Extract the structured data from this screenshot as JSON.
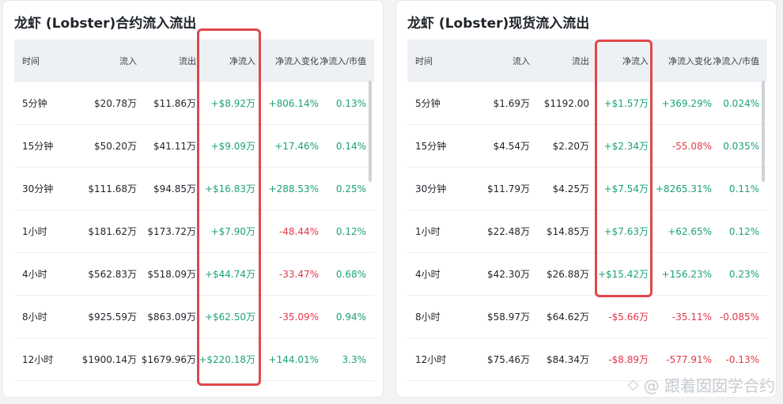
{
  "left_panel": {
    "title": "龙虾 (Lobster)合约流入流出",
    "headers": [
      "时间",
      "流入",
      "流出",
      "净流入",
      "净流入变化",
      "净流入/市值"
    ],
    "rows": [
      [
        "5分钟",
        "$20.78万",
        "$11.86万",
        "+$8.92万",
        "+806.14%",
        "0.13%"
      ],
      [
        "15分钟",
        "$50.20万",
        "$41.11万",
        "+$9.09万",
        "+17.46%",
        "0.14%"
      ],
      [
        "30分钟",
        "$111.68万",
        "$94.85万",
        "+$16.83万",
        "+288.53%",
        "0.25%"
      ],
      [
        "1小时",
        "$181.62万",
        "$173.72万",
        "+$7.90万",
        "-48.44%",
        "0.12%"
      ],
      [
        "4小时",
        "$562.83万",
        "$518.09万",
        "+$44.74万",
        "-33.47%",
        "0.68%"
      ],
      [
        "8小时",
        "$925.59万",
        "$863.09万",
        "+$62.50万",
        "-35.09%",
        "0.94%"
      ],
      [
        "12小时",
        "$1900.14万",
        "$1679.96万",
        "+$220.18万",
        "+144.01%",
        "3.3%"
      ]
    ]
  },
  "right_panel": {
    "title": "龙虾 (Lobster)现货流入流出",
    "headers": [
      "时间",
      "流入",
      "流出",
      "净流入",
      "净流入变化",
      "净流入/市值"
    ],
    "rows": [
      [
        "5分钟",
        "$1.69万",
        "$1192.00",
        "+$1.57万",
        "+369.29%",
        "0.024%"
      ],
      [
        "15分钟",
        "$4.54万",
        "$2.20万",
        "+$2.34万",
        "-55.08%",
        "0.035%"
      ],
      [
        "30分钟",
        "$11.79万",
        "$4.25万",
        "+$7.54万",
        "+8265.31%",
        "0.11%"
      ],
      [
        "1小时",
        "$22.48万",
        "$14.85万",
        "+$7.63万",
        "+62.65%",
        "0.12%"
      ],
      [
        "4小时",
        "$42.30万",
        "$26.88万",
        "+$15.42万",
        "+156.23%",
        "0.23%"
      ],
      [
        "8小时",
        "$58.97万",
        "$64.62万",
        "-$5.66万",
        "-35.11%",
        "-0.085%"
      ],
      [
        "12小时",
        "$75.46万",
        "$84.34万",
        "-$8.89万",
        "-577.91%",
        "-0.13%"
      ]
    ]
  },
  "watermark": {
    "text": "@ 跟着囡囡学合约",
    "icon": "diamond-logo-icon"
  },
  "colors": {
    "positive": "#1ba27a",
    "negative": "#e0394b",
    "highlight": "#e0474c",
    "header_bg": "#eef1f4"
  }
}
